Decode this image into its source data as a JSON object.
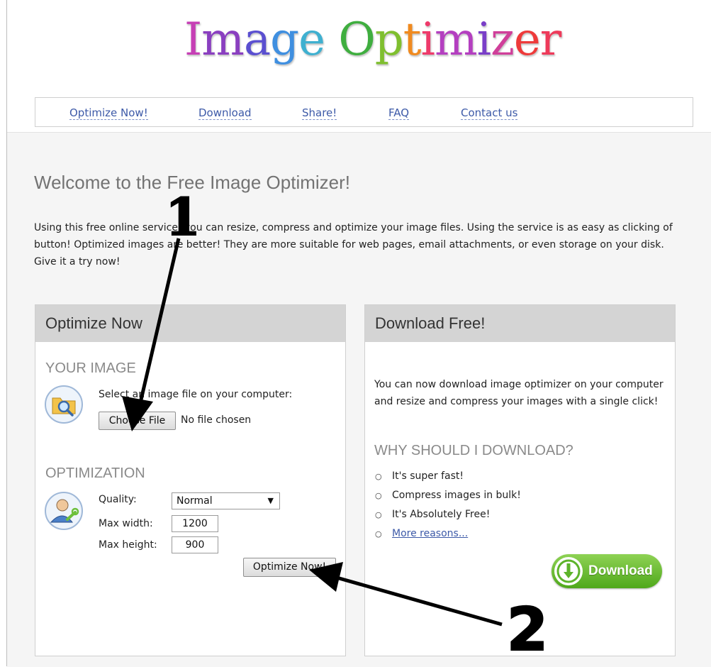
{
  "logo": {
    "letters": [
      {
        "ch": "I",
        "color": "#c63fb5"
      },
      {
        "ch": "m",
        "color": "#8a3fc0"
      },
      {
        "ch": "a",
        "color": "#5a4fd0"
      },
      {
        "ch": "g",
        "color": "#3f8fe0"
      },
      {
        "ch": "e",
        "color": "#3fb0d0"
      },
      {
        "ch": " ",
        "color": "#000000"
      },
      {
        "ch": "O",
        "color": "#3fae3f"
      },
      {
        "ch": "p",
        "color": "#7fbf2f"
      },
      {
        "ch": "t",
        "color": "#f08a1f"
      },
      {
        "ch": "i",
        "color": "#ee3a6a"
      },
      {
        "ch": "m",
        "color": "#b43fc0"
      },
      {
        "ch": "i",
        "color": "#7a3fc8"
      },
      {
        "ch": "z",
        "color": "#d03f9a"
      },
      {
        "ch": "e",
        "color": "#ee3a3a"
      },
      {
        "ch": "r",
        "color": "#ee3a5a"
      }
    ]
  },
  "nav": {
    "items": [
      "Optimize Now!",
      "Download",
      "Share!",
      "FAQ",
      "Contact us"
    ]
  },
  "welcome": {
    "title": "Welcome to the Free Image Optimizer!",
    "intro": "Using this free online service, you can resize, compress and optimize your image files. Using the service is as easy as clicking of button! Optimized images are better! They are more suitable for web pages, email attachments, or even storage on your disk. Give it a try now!"
  },
  "optimize_panel": {
    "title": "Optimize Now",
    "image_section": "YOUR IMAGE",
    "select_label": "Select an image file on your computer:",
    "choose_button": "Choose File",
    "file_status": "No file chosen",
    "opt_section": "OPTIMIZATION",
    "quality_label": "Quality:",
    "quality_value": "Normal",
    "max_width_label": "Max width:",
    "max_width_value": "1200",
    "max_height_label": "Max height:",
    "max_height_value": "900",
    "optimize_button": "Optimize Now!"
  },
  "download_panel": {
    "title": "Download Free!",
    "text": "You can now download image optimizer on your computer and resize and compress your images with a single click!",
    "why_title": "WHY SHOULD I DOWNLOAD?",
    "reasons": [
      "It's super fast!",
      "Compress images in bulk!",
      "It's Absolutely Free!"
    ],
    "more_link": "More reasons...",
    "download_button": "Download",
    "button_color": "#5db42a"
  },
  "annotations": {
    "label_1": "1",
    "label_2": "2"
  }
}
